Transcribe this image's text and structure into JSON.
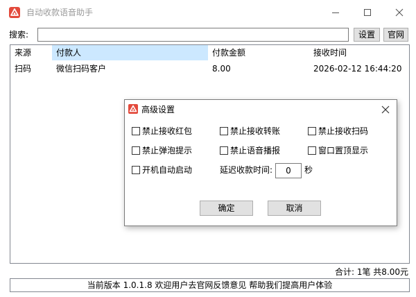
{
  "window": {
    "title": "自动收款语音助手"
  },
  "search": {
    "label": "搜索:",
    "value": "",
    "settings_label": "设置",
    "website_label": "官网"
  },
  "table": {
    "columns": [
      "来源",
      "付款人",
      "付款金额",
      "接收时间"
    ],
    "rows": [
      {
        "source": "扫码",
        "payer": "微信扫码客户",
        "amount": "8.00",
        "time": "2026-02-12 16:44:20"
      }
    ]
  },
  "summary": "合计: 1笔 共8.00元",
  "status": "当前版本 1.0.1.8 欢迎用户去官网反馈意见 帮助我们提高用户体验",
  "dialog": {
    "title": "高级设置",
    "options": {
      "block_red_packet": "禁止接收红包",
      "block_transfer": "禁止接收转账",
      "block_scan": "禁止接收扫码",
      "block_popup": "禁止弹泡提示",
      "block_voice": "禁止语音播报",
      "window_topmost": "窗口置顶显示",
      "auto_start": "开机自动启动"
    },
    "delay_label": "延迟收款时间:",
    "delay_value": "0",
    "delay_unit": "秒",
    "ok_label": "确定",
    "cancel_label": "取消"
  },
  "icons": {
    "app": "app-logo-icon",
    "minimize": "minimize-icon",
    "maximize": "maximize-icon",
    "close": "close-icon"
  },
  "colors": {
    "app_icon": "#e34a3c",
    "header_highlight": "#cce8ff",
    "button_face": "#e1e1e1"
  }
}
